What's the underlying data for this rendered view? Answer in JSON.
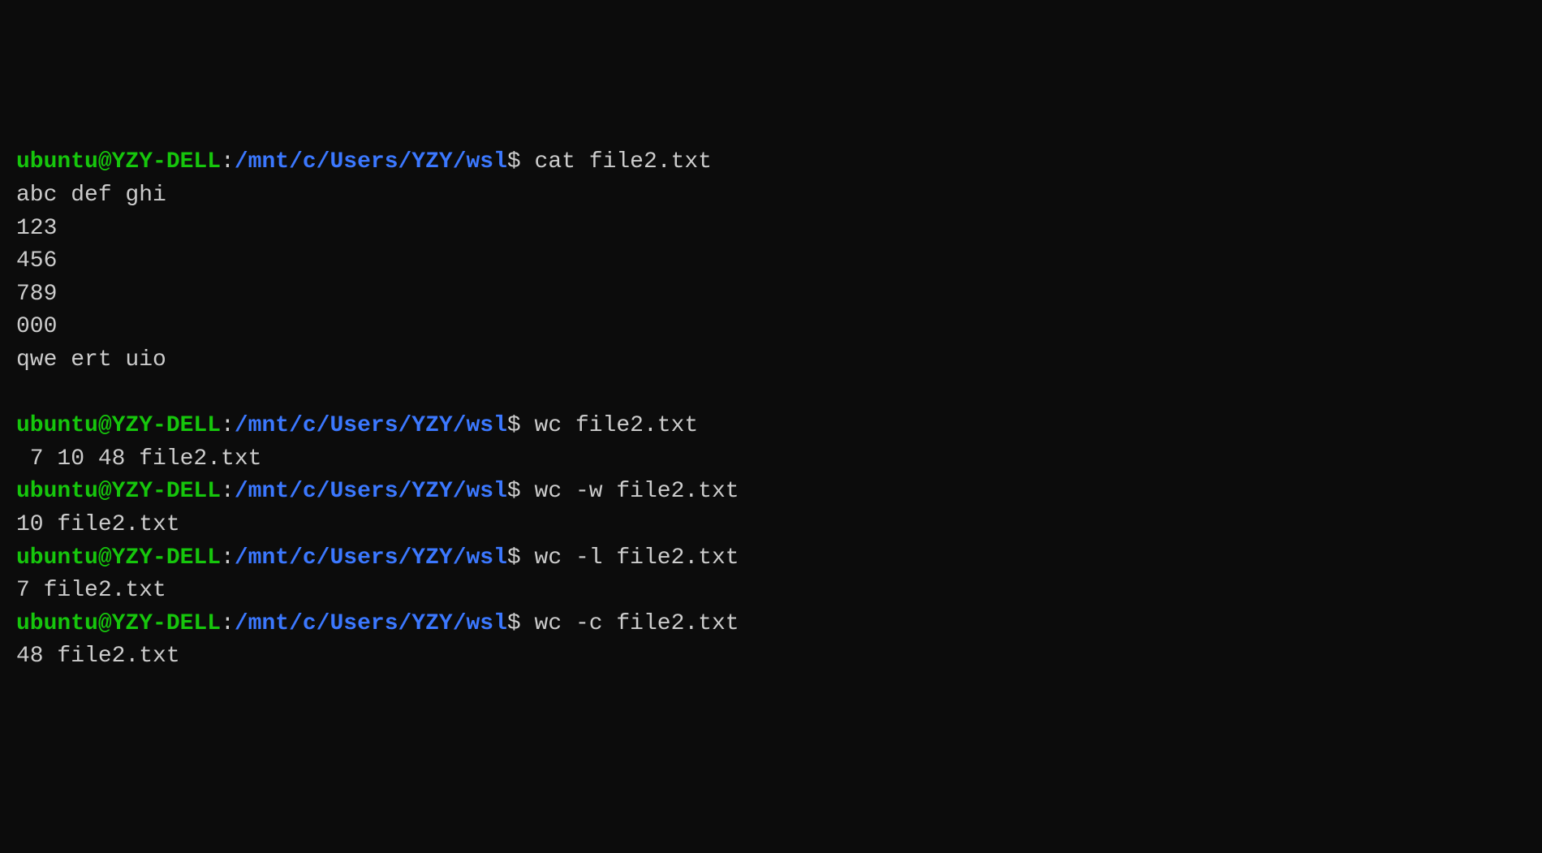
{
  "prompt": {
    "user": "ubuntu@YZY-DELL",
    "colon": ":",
    "path": "/mnt/c/Users/YZY/wsl",
    "dollar": "$"
  },
  "lines": [
    {
      "type": "prompt",
      "command": " cat file2.txt"
    },
    {
      "type": "output",
      "text": "abc def ghi"
    },
    {
      "type": "output",
      "text": "123"
    },
    {
      "type": "output",
      "text": "456"
    },
    {
      "type": "output",
      "text": "789"
    },
    {
      "type": "output",
      "text": "000"
    },
    {
      "type": "output",
      "text": "qwe ert uio"
    },
    {
      "type": "output",
      "text": ""
    },
    {
      "type": "prompt",
      "command": " wc file2.txt"
    },
    {
      "type": "output",
      "text": " 7 10 48 file2.txt"
    },
    {
      "type": "prompt",
      "command": " wc -w file2.txt"
    },
    {
      "type": "output",
      "text": "10 file2.txt"
    },
    {
      "type": "prompt",
      "command": " wc -l file2.txt"
    },
    {
      "type": "output",
      "text": "7 file2.txt"
    },
    {
      "type": "prompt",
      "command": " wc -c file2.txt"
    },
    {
      "type": "output",
      "text": "48 file2.txt"
    }
  ]
}
